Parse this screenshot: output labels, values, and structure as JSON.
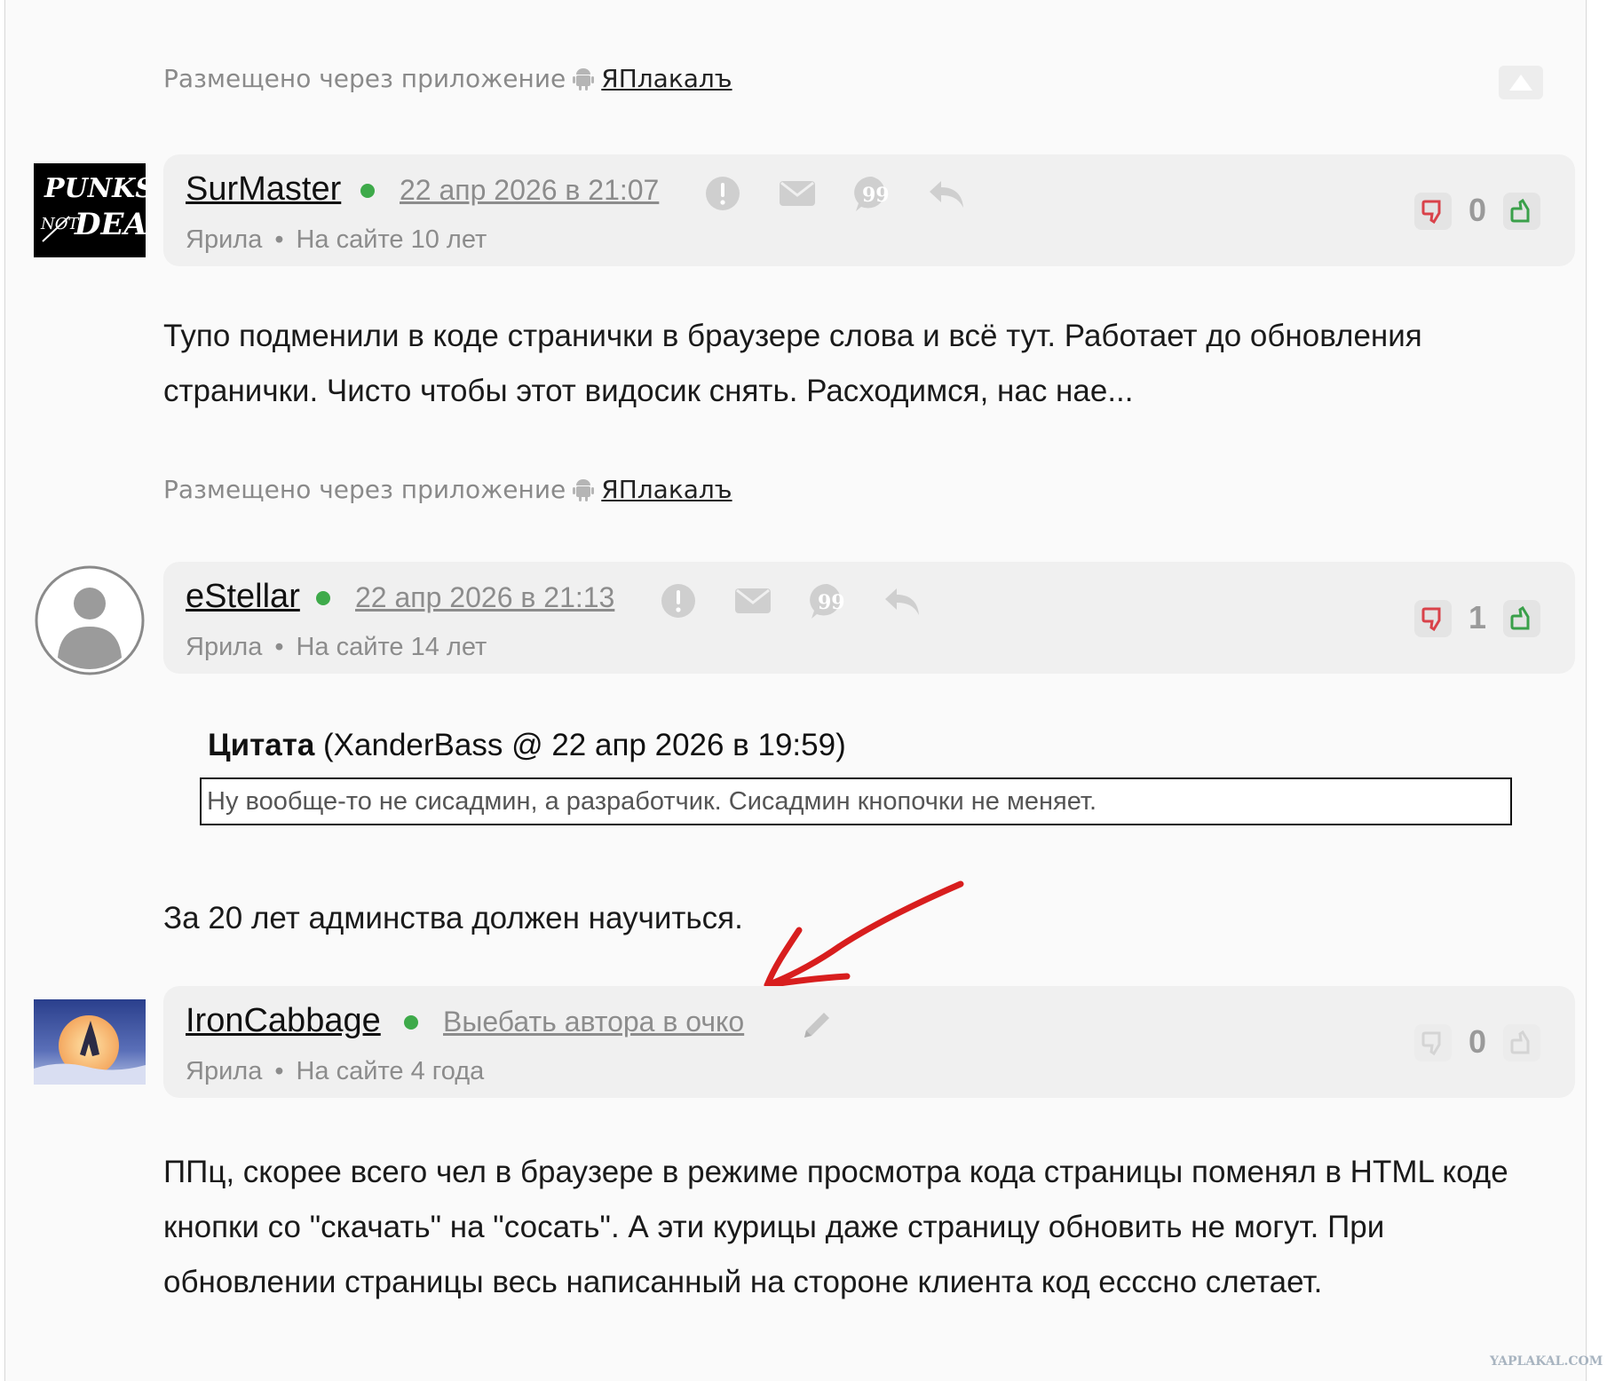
{
  "posted_via": {
    "label": "Размещено через приложение",
    "app_name": "ЯПлакалъ"
  },
  "posts": [
    {
      "username": "SurMaster",
      "date": "22 апр 2026 в 21:07",
      "rank": "Ярила",
      "tenure": "На сайте 10 лет",
      "votes": "0",
      "avatar_text": "PUNKS NOT DEAD",
      "body": "Тупо подменили в коде странички в браузере слова и всё тут. Работает до обновления странички. Чисто чтобы этот видосик снять. Расходимся, нас нае..."
    },
    {
      "username": "eStellar",
      "date": "22 апр 2026 в 21:13",
      "rank": "Ярила",
      "tenure": "На сайте 14 лет",
      "votes": "1",
      "quote_label": "Цитата",
      "quote_source": "(XanderBass @ 22 апр 2026 в 19:59)",
      "quote_text": "Ну вообще-то не сисадмин, а разработчик. Сисадмин кнопочки не меняет.",
      "body": "За 20 лет админства должен научиться."
    },
    {
      "username": "IronCabbage",
      "date": "Выебать автора в очко",
      "rank": "Ярила",
      "tenure": "На сайте 4 года",
      "votes": "0",
      "body": "ППц, скорее всего чел в браузере в режиме просмотра кода страницы поменял в HTML коде кнопки со \"скачать\" на \"сосать\". А эти курицы даже страницу обновить не могут. При обновлении страницы весь написанный на стороне клиента код ессcно слетает."
    }
  ],
  "watermark": "YAPLAKAL.COM",
  "colors": {
    "online": "#3eaa4a",
    "vote_down": "#d9424a",
    "vote_up": "#3aa04a",
    "annotation_arrow": "#d81e1e"
  },
  "icons": [
    "android-icon",
    "scroll-top-icon",
    "report-icon",
    "message-icon",
    "quote-icon",
    "reply-icon",
    "thumb-down-icon",
    "thumb-up-icon",
    "pencil-icon"
  ]
}
